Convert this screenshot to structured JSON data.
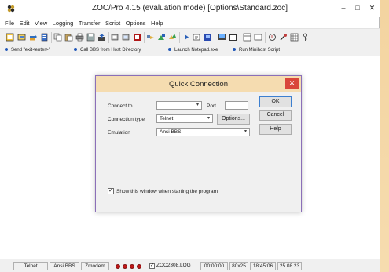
{
  "window": {
    "title": "ZOC/Pro 4.15  (evaluation mode) [Options\\Standard.zoc]",
    "min_glyph": "–",
    "max_glyph": "□",
    "close_glyph": "✕"
  },
  "menu": [
    "File",
    "Edit",
    "View",
    "Logging",
    "Transfer",
    "Script",
    "Options",
    "Help"
  ],
  "toolbar_icons": [
    "new-session-icon",
    "open-icon",
    "transfer-icon",
    "phonebook-icon",
    "copy-icon",
    "paste-icon",
    "print-icon",
    "save-icon",
    "upload-icon",
    "download-icon",
    "clipboard-icon",
    "host-icon",
    "hand-icon",
    "arrow-up-icon",
    "play-icon",
    "connect-icon",
    "disconnect-icon",
    "monitor-icon",
    "terminal-icon",
    "window-icon",
    "settings-icon",
    "tools-icon",
    "grid-icon",
    "key-icon"
  ],
  "quickbar": [
    "Send \"exit<enter>\"",
    "Call BBS from Host Directory",
    "Launch Notepad.exe",
    "Run Minihost Script"
  ],
  "dialog": {
    "title": "Quick Connection",
    "close_glyph": "✕",
    "connect_to_label": "Connect to",
    "connect_to_value": "",
    "port_label": "Port",
    "port_value": "",
    "connection_type_label": "Connection type",
    "connection_type_value": "Telnet",
    "options_button": "Options...",
    "emulation_label": "Emulation",
    "emulation_value": "Ansi BBS",
    "ok_button": "OK",
    "cancel_button": "Cancel",
    "help_button": "Help",
    "show_window_label": "Show this window when starting the program",
    "show_window_checked": true,
    "check_glyph": "✓"
  },
  "statusbar": {
    "connection_type": "Telnet",
    "emulation": "Ansi BBS",
    "transfer": "Zmodem",
    "log_checked": true,
    "log_file": "ZOC2308.LOG",
    "elapsed": "00:00:00",
    "dimensions": "80x25",
    "time": "18:45:06",
    "date": "25.08.23",
    "led_color": "#c01818"
  }
}
